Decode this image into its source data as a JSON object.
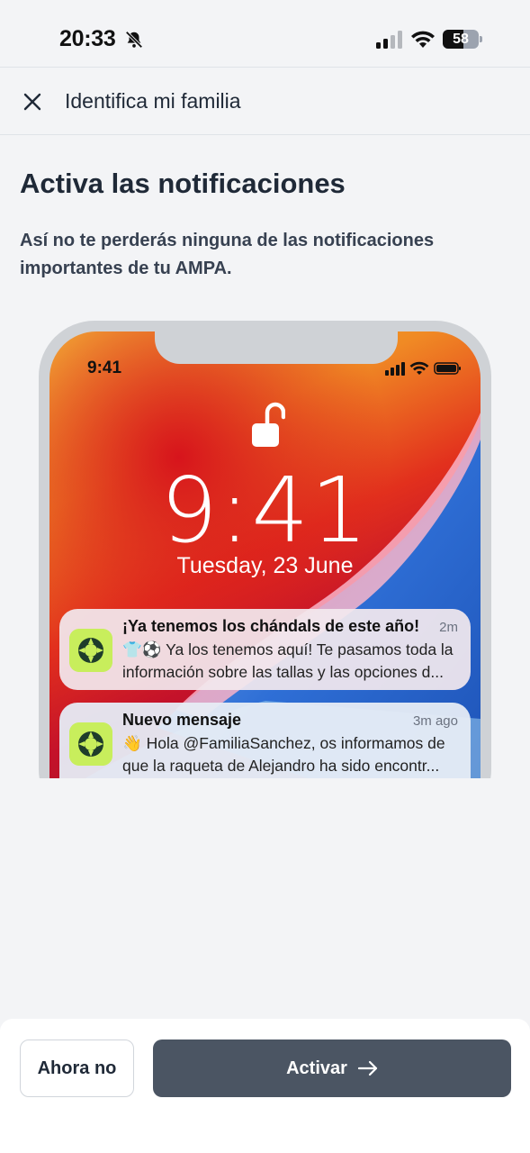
{
  "status_bar": {
    "time": "20:33",
    "battery_level": "58",
    "battery_fraction": 0.58,
    "icons": [
      "bell-off-icon",
      "signal-icon",
      "wifi-icon",
      "battery-icon"
    ]
  },
  "header": {
    "title": "Identifica mi familia",
    "close_icon": "close-icon"
  },
  "main": {
    "title": "Activa las notificaciones",
    "description": "Así no te perderás ninguna de las notificaciones importantes de tu AMPA."
  },
  "illustration": {
    "status_time": "9:41",
    "clock": "9:41",
    "date": "Tuesday, 23 June",
    "notifications": [
      {
        "title": "¡Ya tenemos los chándals de este año!",
        "time": "2m",
        "line1": "👕⚽ Ya los tenemos aquí! Te pasamos toda la",
        "line2": "información sobre las tallas y las opciones d..."
      },
      {
        "title": "Nuevo mensaje",
        "time": "3m ago",
        "line1": "👋 Hola @FamiliaSanchez, os informamos de",
        "line2": "que la raqueta de Alejandro ha sido encontr..."
      }
    ]
  },
  "actions": {
    "later_label": "Ahora no",
    "activate_label": "Activar"
  },
  "colors": {
    "background": "#f3f4f6",
    "primary_button": "#4b5563",
    "app_icon": "#c8ee5c"
  }
}
